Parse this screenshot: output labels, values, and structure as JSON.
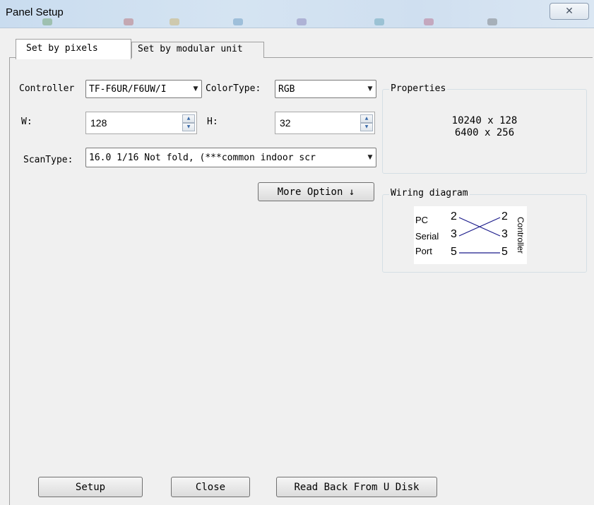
{
  "window": {
    "title": "Panel Setup",
    "close_glyph": "✕"
  },
  "tabs": [
    {
      "label": "Set by pixels",
      "active": true
    },
    {
      "label": "Set by modular unit",
      "active": false
    }
  ],
  "form": {
    "controller_label": "Controller",
    "controller_value": "TF-F6UR/F6UW/I",
    "colortype_label": "ColorType:",
    "colortype_value": "RGB",
    "w_label": "W:",
    "w_value": "128",
    "h_label": "H:",
    "h_value": "32",
    "scantype_label": "ScanType:",
    "scantype_value": "16.0 1/16 Not fold, (***common indoor scr"
  },
  "more_option_label": "More Option ↓",
  "properties": {
    "title": "Properties",
    "lines": [
      "10240 x 128",
      "6400 x 256"
    ]
  },
  "wiring": {
    "title": "Wiring diagram",
    "left_labels": [
      "PC",
      "Serial",
      "Port"
    ],
    "pins": [
      "2",
      "3",
      "5"
    ],
    "right_label": "Controller"
  },
  "buttons": {
    "setup": "Setup",
    "close": "Close",
    "read_back": "Read Back From U Disk"
  },
  "icons": {
    "dropdown": "▼",
    "spin_up": "▲",
    "spin_down": "▼"
  }
}
